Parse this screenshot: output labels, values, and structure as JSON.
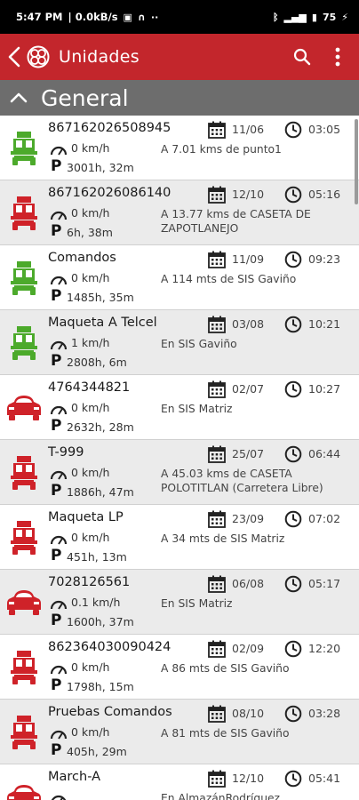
{
  "status_bar": {
    "time": "5:47 PM",
    "net_speed": "0.0kB/s",
    "battery": "75"
  },
  "header": {
    "title": "Unidades"
  },
  "section": {
    "title": "General"
  },
  "colors": {
    "brand": "#c3262c",
    "green": "#4caa2b",
    "red": "#cf2229"
  },
  "units": [
    {
      "name": "867162026508945",
      "speed": "0 km/h",
      "parked": "3001h, 32m",
      "location": "A 7.01 kms de punto1",
      "date": "11/06",
      "time": "03:05",
      "vehicle": "truck",
      "color": "green"
    },
    {
      "name": "867162026086140",
      "speed": "0 km/h",
      "parked": "6h, 38m",
      "location": "A 13.77 kms de CASETA DE ZAPOTLANEJO",
      "date": "12/10",
      "time": "05:16",
      "vehicle": "truck",
      "color": "red"
    },
    {
      "name": "Comandos",
      "speed": "0 km/h",
      "parked": "1485h, 35m",
      "location": "A 114 mts de SIS Gaviño",
      "date": "11/09",
      "time": "09:23",
      "vehicle": "truck",
      "color": "green"
    },
    {
      "name": "Maqueta A Telcel",
      "speed": "1 km/h",
      "parked": "2808h, 6m",
      "location": "En SIS Gaviño",
      "date": "03/08",
      "time": "10:21",
      "vehicle": "truck",
      "color": "green"
    },
    {
      "name": "4764344821",
      "speed": "0 km/h",
      "parked": "2632h, 28m",
      "location": "En SIS Matriz",
      "date": "02/07",
      "time": "10:27",
      "vehicle": "car",
      "color": "red"
    },
    {
      "name": "T-999",
      "speed": "0 km/h",
      "parked": "1886h, 47m",
      "location": "A 45.03 kms de CASETA POLOTITLAN  (Carretera Libre)",
      "date": "25/07",
      "time": "06:44",
      "vehicle": "truck",
      "color": "red"
    },
    {
      "name": "Maqueta LP",
      "speed": "0 km/h",
      "parked": "451h, 13m",
      "location": "A 34 mts de SIS Matriz",
      "date": "23/09",
      "time": "07:02",
      "vehicle": "truck",
      "color": "red"
    },
    {
      "name": "7028126561",
      "speed": "0.1 km/h",
      "parked": "1600h, 37m",
      "location": "En SIS Matriz",
      "date": "06/08",
      "time": "05:17",
      "vehicle": "car",
      "color": "red"
    },
    {
      "name": "862364030090424",
      "speed": "0 km/h",
      "parked": "1798h, 15m",
      "location": "A 86 mts de SIS Gaviño",
      "date": "02/09",
      "time": "12:20",
      "vehicle": "truck",
      "color": "red"
    },
    {
      "name": "Pruebas Comandos",
      "speed": "0 km/h",
      "parked": "405h, 29m",
      "location": "A 81 mts de SIS Gaviño",
      "date": "08/10",
      "time": "03:28",
      "vehicle": "truck",
      "color": "red"
    },
    {
      "name": "March-A",
      "speed": "",
      "parked": "",
      "location": "En AlmazánRodríguez",
      "date": "12/10",
      "time": "05:41",
      "vehicle": "car",
      "color": "red"
    }
  ]
}
